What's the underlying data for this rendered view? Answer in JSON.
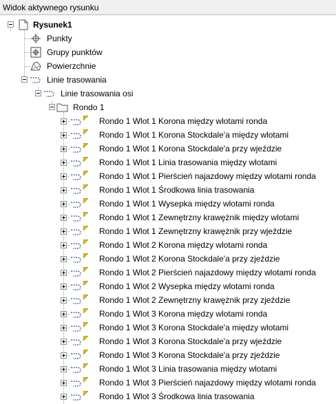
{
  "window": {
    "title": "Widok aktywnego rysunku"
  },
  "tree": {
    "root": {
      "label": "Rysunek1"
    },
    "points": {
      "label": "Punkty"
    },
    "point_groups": {
      "label": "Grupy punktów"
    },
    "surfaces": {
      "label": "Powierzchnie"
    },
    "alignments": {
      "label": "Linie trasowania"
    },
    "centerline_alignments": {
      "label": "Linie trasowania osi"
    },
    "roundabout_folder": {
      "label": "Rondo 1"
    },
    "roundabout_items": [
      "Rondo 1 Wlot 1 Korona między wlotami ronda",
      "Rondo 1 Wlot 1 Korona Stockdale'a między wlotami",
      "Rondo 1 Wlot 1 Korona Stockdale'a przy wjeździe",
      "Rondo 1 Wlot 1 Linia trasowania między wlotami",
      "Rondo 1 Wlot 1 Pierścień najazdowy między wlotami ronda",
      "Rondo 1 Wlot 1 Środkowa linia trasowania",
      "Rondo 1 Wlot 1 Wysepka między wlotami ronda",
      "Rondo 1 Wlot 1 Zewnętrzny krawężnik między wlotami",
      "Rondo 1 Wlot 1 Zewnętrzny krawężnik przy wjeździe",
      "Rondo 1 Wlot 2 Korona między wlotami ronda",
      "Rondo 1 Wlot 2 Korona Stockdale'a przy zjeździe",
      "Rondo 1 Wlot 2 Pierścień najazdowy między wlotami ronda",
      "Rondo 1 Wlot 2 Wysepka między wlotami ronda",
      "Rondo 1 Wlot 2 Zewnętrzny krawężnik przy zjeździe",
      "Rondo 1 Wlot 3 Korona między wlotami ronda",
      "Rondo 1 Wlot 3 Korona Stockdale'a między wlotami",
      "Rondo 1 Wlot 3 Korona Stockdale'a przy wjeździe",
      "Rondo 1 Wlot 3 Korona Stockdale'a przy zjeździe",
      "Rondo 1 Wlot 3 Linia trasowania między wlotami",
      "Rondo 1 Wlot 3 Pierścień najazdowy między wlotami ronda",
      "Rondo 1 Wlot 3 Środkowa linia trasowania"
    ]
  },
  "colors": {
    "titlebar_bg": "#f0f0f0",
    "tree_lines": "#a0a0a0",
    "alignment_icon": "#2a4a8c",
    "flag_yellow": "#e8c000",
    "folder_fill": "#fafafa"
  }
}
